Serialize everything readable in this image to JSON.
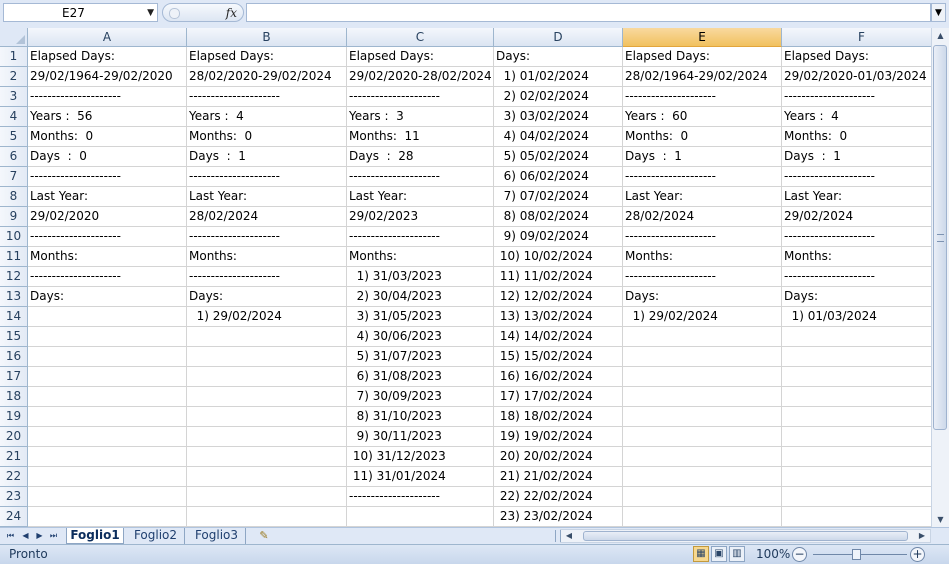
{
  "formula_bar": {
    "name_box": "E27",
    "fx_label": "fx",
    "formula": ""
  },
  "columns": [
    "A",
    "B",
    "C",
    "D",
    "E",
    "F"
  ],
  "selected_column": "E",
  "rows": [
    "1",
    "2",
    "3",
    "4",
    "5",
    "6",
    "7",
    "8",
    "9",
    "10",
    "11",
    "12",
    "13",
    "14",
    "15",
    "16",
    "17",
    "18",
    "19",
    "20",
    "21",
    "22",
    "23",
    "24"
  ],
  "cells": {
    "A": [
      "Elapsed Days:",
      "29/02/1964-29/02/2020",
      "---------------------",
      "Years :  56",
      "Months:  0",
      "Days  :  0",
      "---------------------",
      "Last Year:",
      "29/02/2020",
      "---------------------",
      "Months:",
      "---------------------",
      "Days:",
      "",
      "",
      "",
      "",
      "",
      "",
      "",
      "",
      "",
      "",
      ""
    ],
    "B": [
      "Elapsed Days:",
      "28/02/2020-29/02/2024",
      "---------------------",
      "Years :  4",
      "Months:  0",
      "Days  :  1",
      "---------------------",
      "Last Year:",
      "28/02/2024",
      "---------------------",
      "Months:",
      "---------------------",
      "Days:",
      "  1) 29/02/2024",
      "",
      "",
      "",
      "",
      "",
      "",
      "",
      "",
      "",
      ""
    ],
    "C": [
      "Elapsed Days:",
      "29/02/2020-28/02/2024",
      "---------------------",
      "Years :  3",
      "Months:  11",
      "Days  :  28",
      "---------------------",
      "Last Year:",
      "29/02/2023",
      "---------------------",
      "Months:",
      "  1) 31/03/2023",
      "  2) 30/04/2023",
      "  3) 31/05/2023",
      "  4) 30/06/2023",
      "  5) 31/07/2023",
      "  6) 31/08/2023",
      "  7) 30/09/2023",
      "  8) 31/10/2023",
      "  9) 30/11/2023",
      " 10) 31/12/2023",
      " 11) 31/01/2024",
      "---------------------",
      ""
    ],
    "D": [
      "Days:",
      "  1) 01/02/2024",
      "  2) 02/02/2024",
      "  3) 03/02/2024",
      "  4) 04/02/2024",
      "  5) 05/02/2024",
      "  6) 06/02/2024",
      "  7) 07/02/2024",
      "  8) 08/02/2024",
      "  9) 09/02/2024",
      " 10) 10/02/2024",
      " 11) 11/02/2024",
      " 12) 12/02/2024",
      " 13) 13/02/2024",
      " 14) 14/02/2024",
      " 15) 15/02/2024",
      " 16) 16/02/2024",
      " 17) 17/02/2024",
      " 18) 18/02/2024",
      " 19) 19/02/2024",
      " 20) 20/02/2024",
      " 21) 21/02/2024",
      " 22) 22/02/2024",
      " 23) 23/02/2024"
    ],
    "E": [
      "Elapsed Days:",
      "28/02/1964-29/02/2024",
      "---------------------",
      "Years :  60",
      "Months:  0",
      "Days  :  1",
      "---------------------",
      "Last Year:",
      "28/02/2024",
      "---------------------",
      "Months:",
      "---------------------",
      "Days:",
      "  1) 29/02/2024",
      "",
      "",
      "",
      "",
      "",
      "",
      "",
      "",
      "",
      ""
    ],
    "F": [
      "Elapsed Days:",
      "29/02/2020-01/03/2024",
      "---------------------",
      "Years :  4",
      "Months:  0",
      "Days  :  1",
      "---------------------",
      "Last Year:",
      "29/02/2024",
      "---------------------",
      "Months:",
      "---------------------",
      "Days:",
      "  1) 01/03/2024",
      "",
      "",
      "",
      "",
      "",
      "",
      "",
      "",
      "",
      ""
    ]
  },
  "sheet_tabs": [
    "Foglio1",
    "Foglio2",
    "Foglio3"
  ],
  "active_tab": "Foglio1",
  "status": {
    "mode": "Pronto",
    "zoom": "100%"
  }
}
